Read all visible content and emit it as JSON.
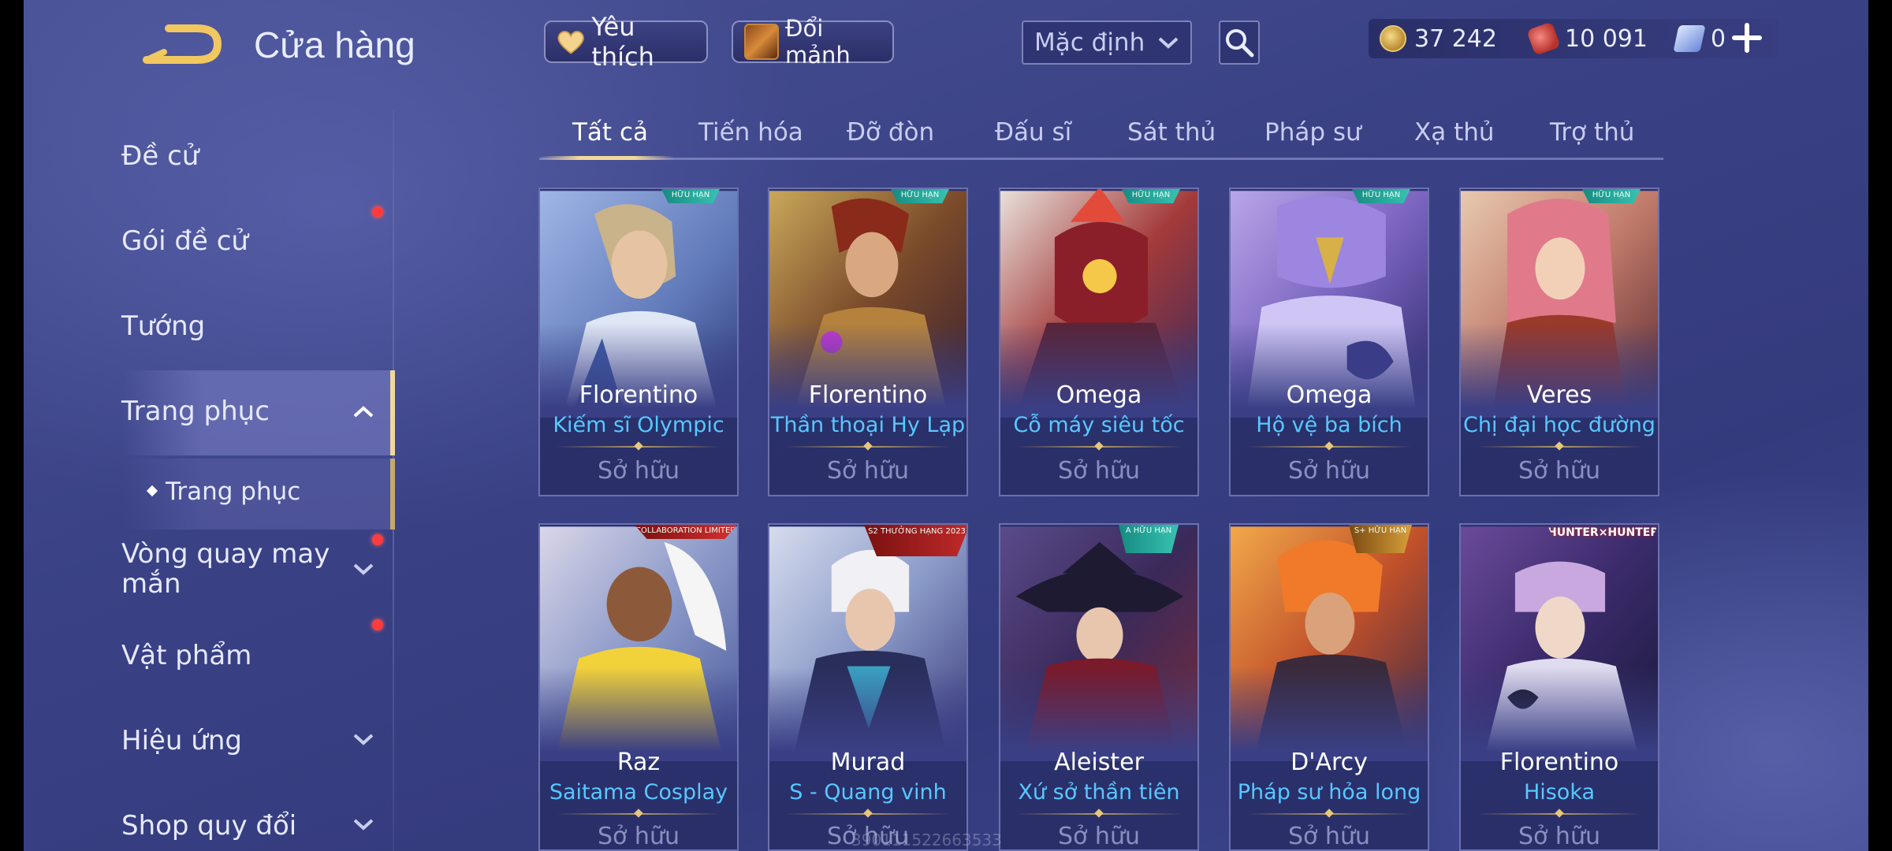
{
  "header": {
    "title": "Cửa hàng",
    "favorite_label": "Yêu thích",
    "shard_label": "Đổi mảnh",
    "sort_selected": "Mặc định",
    "currencies": [
      {
        "icon": "gold-coin-icon",
        "value": "37 242"
      },
      {
        "icon": "voucher-icon",
        "value": "10 091"
      },
      {
        "icon": "gem-icon",
        "value": "0"
      }
    ]
  },
  "sidebar": {
    "items": [
      {
        "label": "Đề cử"
      },
      {
        "label": "Gói đề cử"
      },
      {
        "label": "Tướng"
      },
      {
        "label": "Trang phục"
      },
      {
        "label": "Trang phục"
      },
      {
        "label": "Vòng quay may mắn"
      },
      {
        "label": "Vật phẩm"
      },
      {
        "label": "Hiệu ứng"
      },
      {
        "label": "Shop quy đổi"
      }
    ]
  },
  "tabs": [
    "Tất cả",
    "Tiến hóa",
    "Đỡ đòn",
    "Đấu sĩ",
    "Sát thủ",
    "Pháp sư",
    "Xạ thủ",
    "Trợ thủ"
  ],
  "cards": [
    {
      "hero": "Florentino",
      "skin": "Kiếm sĩ Olympic",
      "status": "Sở hữu",
      "badge": "HỮU HẠN"
    },
    {
      "hero": "Florentino",
      "skin": "Thần thoại Hy Lạp",
      "status": "Sở hữu",
      "badge": "HỮU HẠN"
    },
    {
      "hero": "Omega",
      "skin": "Cỗ máy siêu tốc",
      "status": "Sở hữu",
      "badge": "HỮU HẠN"
    },
    {
      "hero": "Omega",
      "skin": "Hộ vệ ba bích",
      "status": "Sở hữu",
      "badge": "HỮU HẠN"
    },
    {
      "hero": "Veres",
      "skin": "Chị đại học đường",
      "status": "Sở hữu",
      "badge": "HỮU HẠN"
    },
    {
      "hero": "Raz",
      "skin": "Saitama Cosplay",
      "status": "Sở hữu",
      "badge": "COLLABORATION LIMITED"
    },
    {
      "hero": "Murad",
      "skin": "S - Quang vinh",
      "status": "Sở hữu",
      "badge": "S2 THƯỞNG HẠNG 2023"
    },
    {
      "hero": "Aleister",
      "skin": "Xứ sở thần tiên",
      "status": "Sở hữu",
      "badge": "A HỮU HẠN"
    },
    {
      "hero": "D'Arcy",
      "skin": "Pháp sư hỏa long",
      "status": "Sở hữu",
      "badge": "S+ HỮU HẠN"
    },
    {
      "hero": "Florentino",
      "skin": "Hisoka",
      "status": "Sở hữu",
      "badge": "HUNTER×HUNTER"
    }
  ],
  "watermark": "390111522663533",
  "colors": {
    "accent_gold": "#f3d999",
    "skin_name_blue": "#58c8ff",
    "notification_red": "#ff3b3b",
    "owned_grey": "#8b8fbf"
  }
}
